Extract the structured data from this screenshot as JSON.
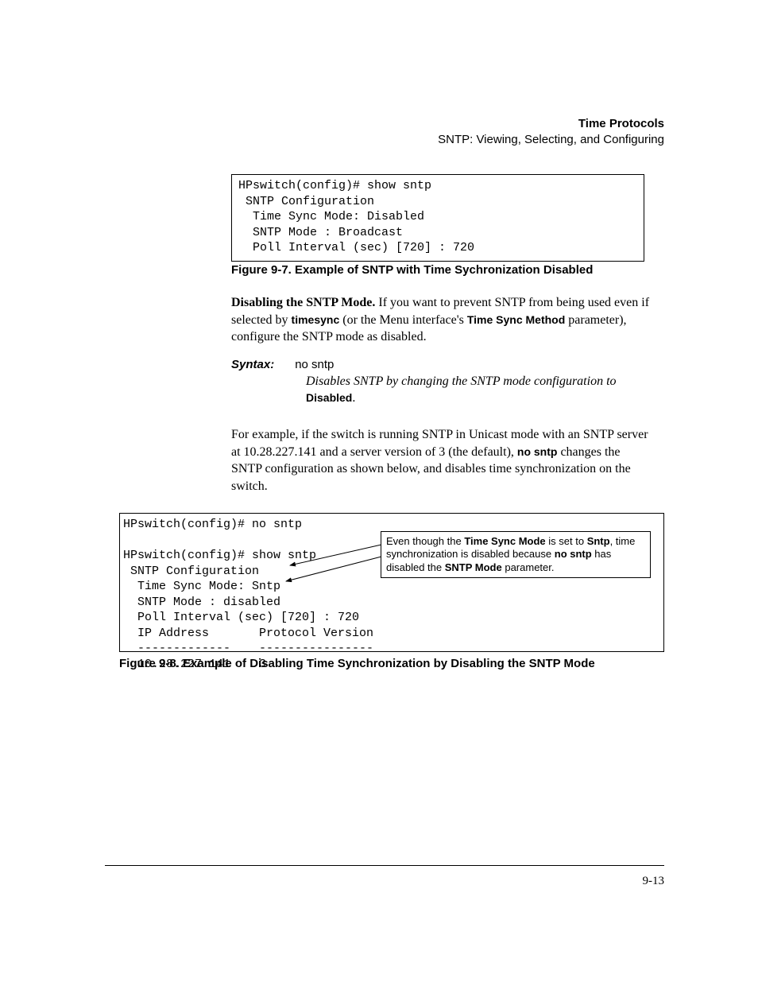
{
  "header": {
    "title": "Time Protocols",
    "subtitle": "SNTP: Viewing, Selecting, and Configuring"
  },
  "code1": "HPswitch(config)# show sntp\n SNTP Configuration\n  Time Sync Mode: Disabled\n  SNTP Mode : Broadcast\n  Poll Interval (sec) [720] : 720",
  "caption1": "Figure 9-7.  Example of SNTP with Time Sychronization Disabled",
  "para1_lead": "Disabling the SNTP Mode.",
  "para1_a": " If you want to prevent SNTP from being used even if selected by ",
  "para1_ts": "timesync",
  "para1_b": " (or the Menu interface's ",
  "para1_tsm": "Time Sync Method",
  "para1_c": " param­eter), configure the SNTP mode as disabled.",
  "syntax": {
    "label": "Syntax:",
    "cmd": "no sntp",
    "desc_a": "Disables SNTP by changing the SNTP mode configuration to ",
    "desc_b": "Disabled",
    "desc_c": "."
  },
  "para2_a": "For example, if the switch is running SNTP in Unicast mode with an SNTP server at 10.28.227.141 and a server version of 3 (the default), ",
  "para2_ns": "no sntp",
  "para2_b": " changes the SNTP configuration as shown below, and disables time synchronization on the switch.",
  "code2": "HPswitch(config)# no sntp\n\nHPswitch(config)# show sntp\n SNTP Configuration\n  Time Sync Mode: Sntp\n  SNTP Mode : disabled\n  Poll Interval (sec) [720] : 720\n  IP Address       Protocol Version\n  -------------    ----------------\n  10.28.227.141    3",
  "annotation_a": "Even though the ",
  "annotation_b": "Time Sync Mode",
  "annotation_c": " is set to ",
  "annotation_d": "Sntp",
  "annotation_e": ", time synchronization is disabled because ",
  "annotation_f": "no sntp",
  "annotation_g": " has disabled the ",
  "annotation_h": "SNTP Mode",
  "annotation_i": " parameter.",
  "caption2": "Figure 9-8.   Example of Disabling Time Synchronization by Disabling the SNTP Mode",
  "pagenum": "9-13"
}
